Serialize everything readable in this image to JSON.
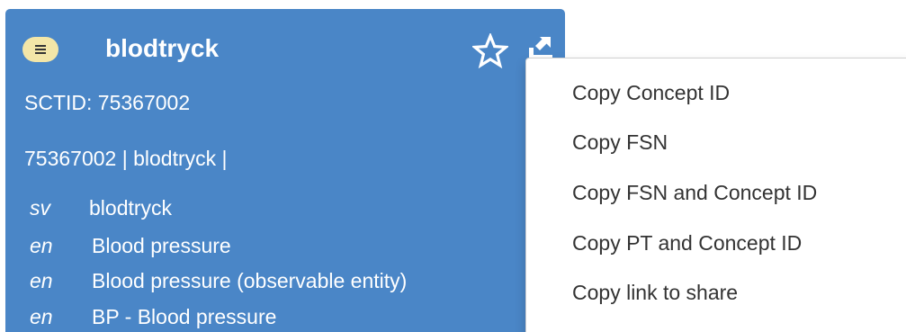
{
  "concept": {
    "title": "blodtryck",
    "sctid_label": "SCTID: 75367002",
    "expression": "75367002 | blodtryck |",
    "definition_status_icon": "lines-icon",
    "badge_color": "#f3e6a8",
    "card_color": "#4a86c7",
    "favorite_icon": "star-outline-icon",
    "menu_icon": "export-arrow-icon",
    "descriptions": [
      {
        "lang": "sv",
        "term": "blodtryck"
      },
      {
        "lang": "en",
        "term": "Blood pressure"
      },
      {
        "lang": "en",
        "term": "Blood pressure (observable entity)"
      },
      {
        "lang": "en",
        "term": "BP - Blood pressure"
      }
    ]
  },
  "context_menu": {
    "items": [
      {
        "label": "Copy Concept ID"
      },
      {
        "label": "Copy FSN"
      },
      {
        "label": "Copy FSN and Concept ID"
      },
      {
        "label": "Copy PT and Concept ID"
      },
      {
        "label": "Copy link to share"
      }
    ]
  }
}
